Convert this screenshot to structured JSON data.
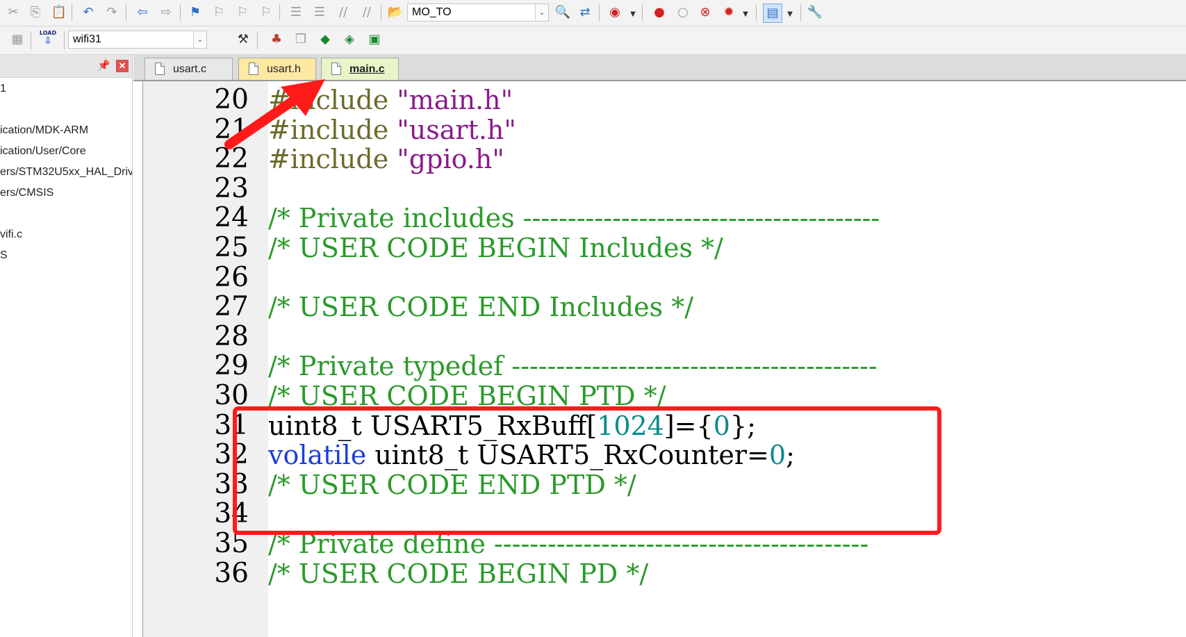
{
  "toolbar1": {
    "target_label": "MO_TO",
    "icons": [
      "cut-icon",
      "copy-icon",
      "paste-icon",
      "undo-icon",
      "redo-icon",
      "nav-back-icon",
      "nav-forward-icon",
      "bookmark-icon",
      "prev-bookmark-icon",
      "next-bookmark-icon",
      "clear-bookmark-icon",
      "indent-icon",
      "unindent-icon",
      "comment-icon",
      "uncomment-icon",
      "find-in-files-icon",
      "find-icon",
      "replace-icon",
      "incremental-find-icon",
      "breakpoint-icon",
      "disable-breakpoint-icon",
      "clear-breakpoints-icon",
      "kill-breakpoints-icon",
      "window-layout-icon",
      "configure-icon"
    ]
  },
  "toolbar2": {
    "target_label": "wifi31",
    "icons": [
      "batch-build-icon",
      "download-icon",
      "target-options-icon",
      "manage-project-icon",
      "file-extensions-icon",
      "manage-packs-icon",
      "select-software-icon",
      "pack-installer-icon"
    ],
    "load_icon_text": "LOAD"
  },
  "project_panel": {
    "items": [
      "1",
      "ication/MDK-ARM",
      "ication/User/Core",
      "ers/STM32U5xx_HAL_Driv",
      "ers/CMSIS",
      "vifi.c",
      "S"
    ]
  },
  "tabs": [
    {
      "label": "usart.c"
    },
    {
      "label": "usart.h"
    },
    {
      "label": "main.c"
    }
  ],
  "editor": {
    "lines": [
      {
        "n": "20",
        "t": [
          {
            "c": "pre",
            "s": "#include "
          },
          {
            "c": "str",
            "s": "\"main.h\""
          }
        ]
      },
      {
        "n": "21",
        "t": [
          {
            "c": "pre",
            "s": "#include "
          },
          {
            "c": "str",
            "s": "\"usart.h\""
          }
        ]
      },
      {
        "n": "22",
        "t": [
          {
            "c": "pre",
            "s": "#include "
          },
          {
            "c": "str",
            "s": "\"gpio.h\""
          }
        ]
      },
      {
        "n": "23",
        "t": []
      },
      {
        "n": "24",
        "t": [
          {
            "c": "com",
            "s": "/* Private includes ----------------------------------------"
          }
        ]
      },
      {
        "n": "25",
        "t": [
          {
            "c": "com",
            "s": "/* USER CODE BEGIN Includes */"
          }
        ]
      },
      {
        "n": "26",
        "t": []
      },
      {
        "n": "27",
        "t": [
          {
            "c": "com",
            "s": "/* USER CODE END Includes */"
          }
        ]
      },
      {
        "n": "28",
        "t": []
      },
      {
        "n": "29",
        "t": [
          {
            "c": "com",
            "s": "/* Private typedef -----------------------------------------"
          }
        ]
      },
      {
        "n": "30",
        "t": [
          {
            "c": "com",
            "s": "/* USER CODE BEGIN PTD */"
          }
        ]
      },
      {
        "n": "31",
        "t": [
          {
            "c": "txt",
            "s": "uint8_t USART5_RxBuff["
          },
          {
            "c": "num",
            "s": "1024"
          },
          {
            "c": "txt",
            "s": "]={"
          },
          {
            "c": "num",
            "s": "0"
          },
          {
            "c": "txt",
            "s": "};"
          }
        ]
      },
      {
        "n": "32",
        "t": [
          {
            "c": "kw",
            "s": "volatile"
          },
          {
            "c": "txt",
            "s": " uint8_t USART5_RxCounter="
          },
          {
            "c": "num",
            "s": "0"
          },
          {
            "c": "txt",
            "s": ";"
          }
        ]
      },
      {
        "n": "33",
        "t": [
          {
            "c": "com",
            "s": "/* USER CODE END PTD */"
          }
        ]
      },
      {
        "n": "34",
        "t": []
      },
      {
        "n": "35",
        "t": [
          {
            "c": "com",
            "s": "/* Private define ------------------------------------------"
          }
        ]
      },
      {
        "n": "36",
        "t": [
          {
            "c": "com",
            "s": "/* USER CODE BEGIN PD */"
          }
        ]
      }
    ]
  },
  "colors": {
    "annotation": "#ff1a1a",
    "comment": "#2a9a2a",
    "string": "#8b1a8b",
    "keyword": "#1c3fd6",
    "number": "#0a8a8a"
  }
}
